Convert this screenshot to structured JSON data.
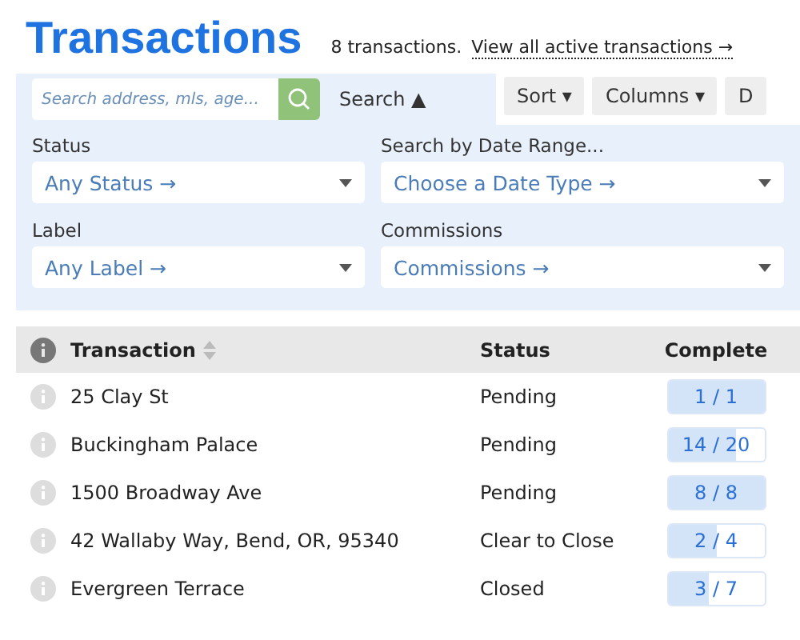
{
  "title": "Transactions",
  "summary": "8 transactions.",
  "summary_link": "View all active transactions →",
  "search": {
    "placeholder": "Search address, mls, age...",
    "toggle": "Search ▲",
    "expanded": true
  },
  "toolbar": [
    "Sort ▾",
    "Columns ▾",
    "D"
  ],
  "filters": [
    {
      "label": "Status",
      "value": "Any Status →"
    },
    {
      "label": "Search by Date Range...",
      "value": "Choose a Date Type →"
    },
    {
      "label": "Label",
      "value": "Any Label →"
    },
    {
      "label": "Commissions",
      "value": "Commissions →"
    }
  ],
  "table": {
    "columns": [
      "Transaction",
      "Status",
      "Complete"
    ],
    "rows": [
      {
        "transaction": "25 Clay St",
        "status": "Pending",
        "complete": "1 / 1",
        "level": 1
      },
      {
        "transaction": "Buckingham Palace",
        "status": "Pending",
        "complete": "14 / 20",
        "level": 0.7
      },
      {
        "transaction": "1500 Broadway Ave",
        "status": "Pending",
        "complete": "8 / 8",
        "level": 1
      },
      {
        "transaction": "42 Wallaby Way, Bend, OR, 95340",
        "status": "Clear to Close",
        "complete": "2 / 4",
        "level": 0.5
      },
      {
        "transaction": "Evergreen Terrace",
        "status": "Closed",
        "complete": "3 / 7",
        "level": 0.43
      }
    ]
  }
}
